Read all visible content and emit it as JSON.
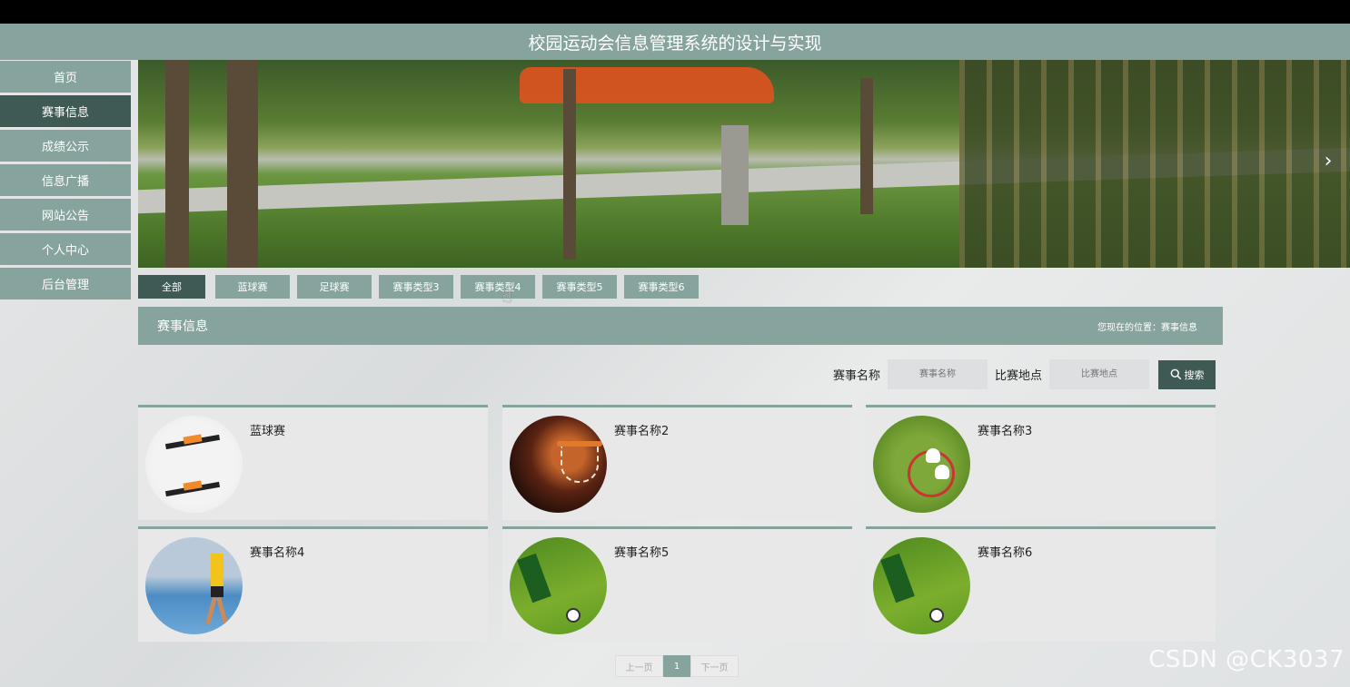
{
  "header": {
    "title": "校园运动会信息管理系统的设计与实现"
  },
  "sidebar": {
    "items": [
      {
        "label": "首页"
      },
      {
        "label": "赛事信息"
      },
      {
        "label": "成绩公示"
      },
      {
        "label": "信息广播"
      },
      {
        "label": "网站公告"
      },
      {
        "label": "个人中心"
      },
      {
        "label": "后台管理"
      }
    ],
    "active_index": 1
  },
  "banner": {
    "next_icon": "chevron-right-icon",
    "next_glyph": "›"
  },
  "tabs": [
    {
      "label": "全部"
    },
    {
      "label": "蓝球赛"
    },
    {
      "label": "足球赛"
    },
    {
      "label": "赛事类型3"
    },
    {
      "label": "赛事类型4"
    },
    {
      "label": "赛事类型5"
    },
    {
      "label": "赛事类型6"
    }
  ],
  "section": {
    "title": "赛事信息",
    "breadcrumb": "您现在的位置：赛事信息"
  },
  "search": {
    "name_label": "赛事名称",
    "name_placeholder": "赛事名称",
    "location_label": "比赛地点",
    "location_placeholder": "比赛地点",
    "button_label": "搜索",
    "button_icon": "search-icon"
  },
  "cards": [
    {
      "name": "蓝球赛",
      "image": "pushup-athletes"
    },
    {
      "name": "赛事名称2",
      "image": "basketball-hoop"
    },
    {
      "name": "赛事名称3",
      "image": "badminton-racket"
    },
    {
      "name": "赛事名称4",
      "image": "runner"
    },
    {
      "name": "赛事名称5",
      "image": "soccer-player"
    },
    {
      "name": "赛事名称6",
      "image": "soccer-player"
    }
  ],
  "pagination": {
    "prev": "上一页",
    "current": "1",
    "next": "下一页"
  },
  "watermark": "CSDN @CK3037",
  "colors": {
    "accent": "#86a49d",
    "accent_dark": "#3f5a54"
  }
}
